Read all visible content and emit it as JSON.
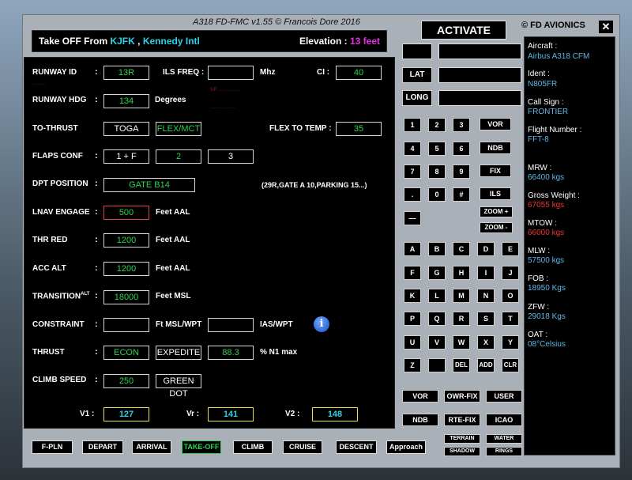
{
  "window": {
    "title": "A318 FD-FMC v1.55 © Francois Dore 2016",
    "brand": "© FD AVIONICS",
    "close": "✕"
  },
  "header": {
    "prefix": "Take OFF From",
    "icao": "KJFK",
    "sep": ",",
    "airport": "Kennedy Intl",
    "elev_label": "Elevation :",
    "elev_value": "13 feet"
  },
  "form": {
    "runway_id_label": "RUNWAY ID",
    "runway_id": "13R",
    "ils_freq_label": "ILS FREQ :",
    "ils_freq": "",
    "mhz": "Mhz",
    "ci_label": "CI :",
    "ci": "40",
    "runway_hdg_label": "RUNWAY HDG",
    "runway_hdg": "134",
    "degrees": "Degrees",
    "to_thrust_label": "TO-THRUST",
    "toga": "TOGA",
    "flex": "FLEX/MCT",
    "flex_to_temp_label": "FLEX TO TEMP :",
    "flex_to_temp": "35",
    "flaps_label": "FLAPS  CONF",
    "flaps_1": "1 + F",
    "flaps_2": "2",
    "flaps_3": "3",
    "dpt_label": "DPT POSITION",
    "dpt": "GATE B14",
    "dpt_hint": "(29R,GATE A 10,PARKING 15...)",
    "lnav_label": "LNAV ENGAGE",
    "lnav": "500",
    "feet_aal": "Feet AAL",
    "thr_red_label": "THR RED",
    "thr_red": "1200",
    "acc_alt_label": "ACC ALT",
    "acc_alt": "1200",
    "transition_label": "TRANSITION",
    "transition_sup": "ALT",
    "transition": "18000",
    "feet_msl": "Feet MSL",
    "constraint_label": "CONSTRAINT",
    "constraint_alt": "",
    "ft_msl_wpt": "Ft MSL/WPT",
    "constraint_ias": "",
    "ias_wpt": "IAS/WPT",
    "thrust_label": "THRUST",
    "econ": "ECON",
    "expedite": "EXPEDITE",
    "n1": "88.3",
    "n1_max": "% N1 max",
    "climb_speed_label": "CLIMB SPEED",
    "climb_speed": "250",
    "green_dot": "GREEN DOT",
    "v1_label": "V1 :",
    "v1": "127",
    "vr_label": "Vr :",
    "vr": "141",
    "v2_label": "V2 :",
    "v2": "148",
    "colon": ":",
    "info_icon": "i"
  },
  "keypad": {
    "lat": "LAT",
    "long": "LONG",
    "digits": [
      "1",
      "2",
      "3",
      "4",
      "5",
      "6",
      "7",
      "8",
      "9",
      ".",
      "0",
      "#"
    ],
    "minus": "—",
    "navaids": [
      "VOR",
      "NDB",
      "FIX",
      "ILS"
    ],
    "zoom_in": "ZOOM +",
    "zoom_out": "ZOOM -",
    "letters": [
      "A",
      "B",
      "C",
      "D",
      "E",
      "F",
      "G",
      "H",
      "I",
      "J",
      "K",
      "L",
      "M",
      "N",
      "O",
      "P",
      "Q",
      "R",
      "S",
      "T",
      "U",
      "V",
      "W",
      "X",
      "Y"
    ],
    "z": "Z",
    "space": "",
    "del": "DEL",
    "add": "ADD",
    "clr": "CLR",
    "row1": [
      "VOR",
      "OWR-FIX",
      "USER"
    ],
    "row2": [
      "NDB",
      "RTE-FIX",
      "ICAO"
    ],
    "terrain": "TERRAIN",
    "water": "WATER",
    "shadow": "SHADOW",
    "rings": "RINGS",
    "activate": "ACTIVATE"
  },
  "side": {
    "aircraft_label": "Aircraft :",
    "aircraft": "Airbus A318 CFM",
    "ident_label": "Ident :",
    "ident": "N805FR",
    "callsign_label": "Call Sign :",
    "callsign": "FRONTIER",
    "flight_label": "Flight Number :",
    "flight": "FFT-8",
    "mrw_label": "MRW :",
    "mrw": "66400 kgs",
    "gross_label": "Gross Weight :",
    "gross": "67055 kgs",
    "mtow_label": "MTOW :",
    "mtow": "66000 kgs",
    "mlw_label": "MLW :",
    "mlw": "57500 kgs",
    "fob_label": "FOB :",
    "fob": "18950 Kgs",
    "zfw_label": "ZFW :",
    "zfw": "29018 Kgs",
    "oat_label": "OAT :",
    "oat": "08°Celsius"
  },
  "bottom_tabs": [
    "F-PLN",
    "DEPART",
    "ARRIVAL",
    "TAKE-OFF",
    "CLIMB",
    "CRUISE",
    "DESCENT",
    "Approach"
  ]
}
